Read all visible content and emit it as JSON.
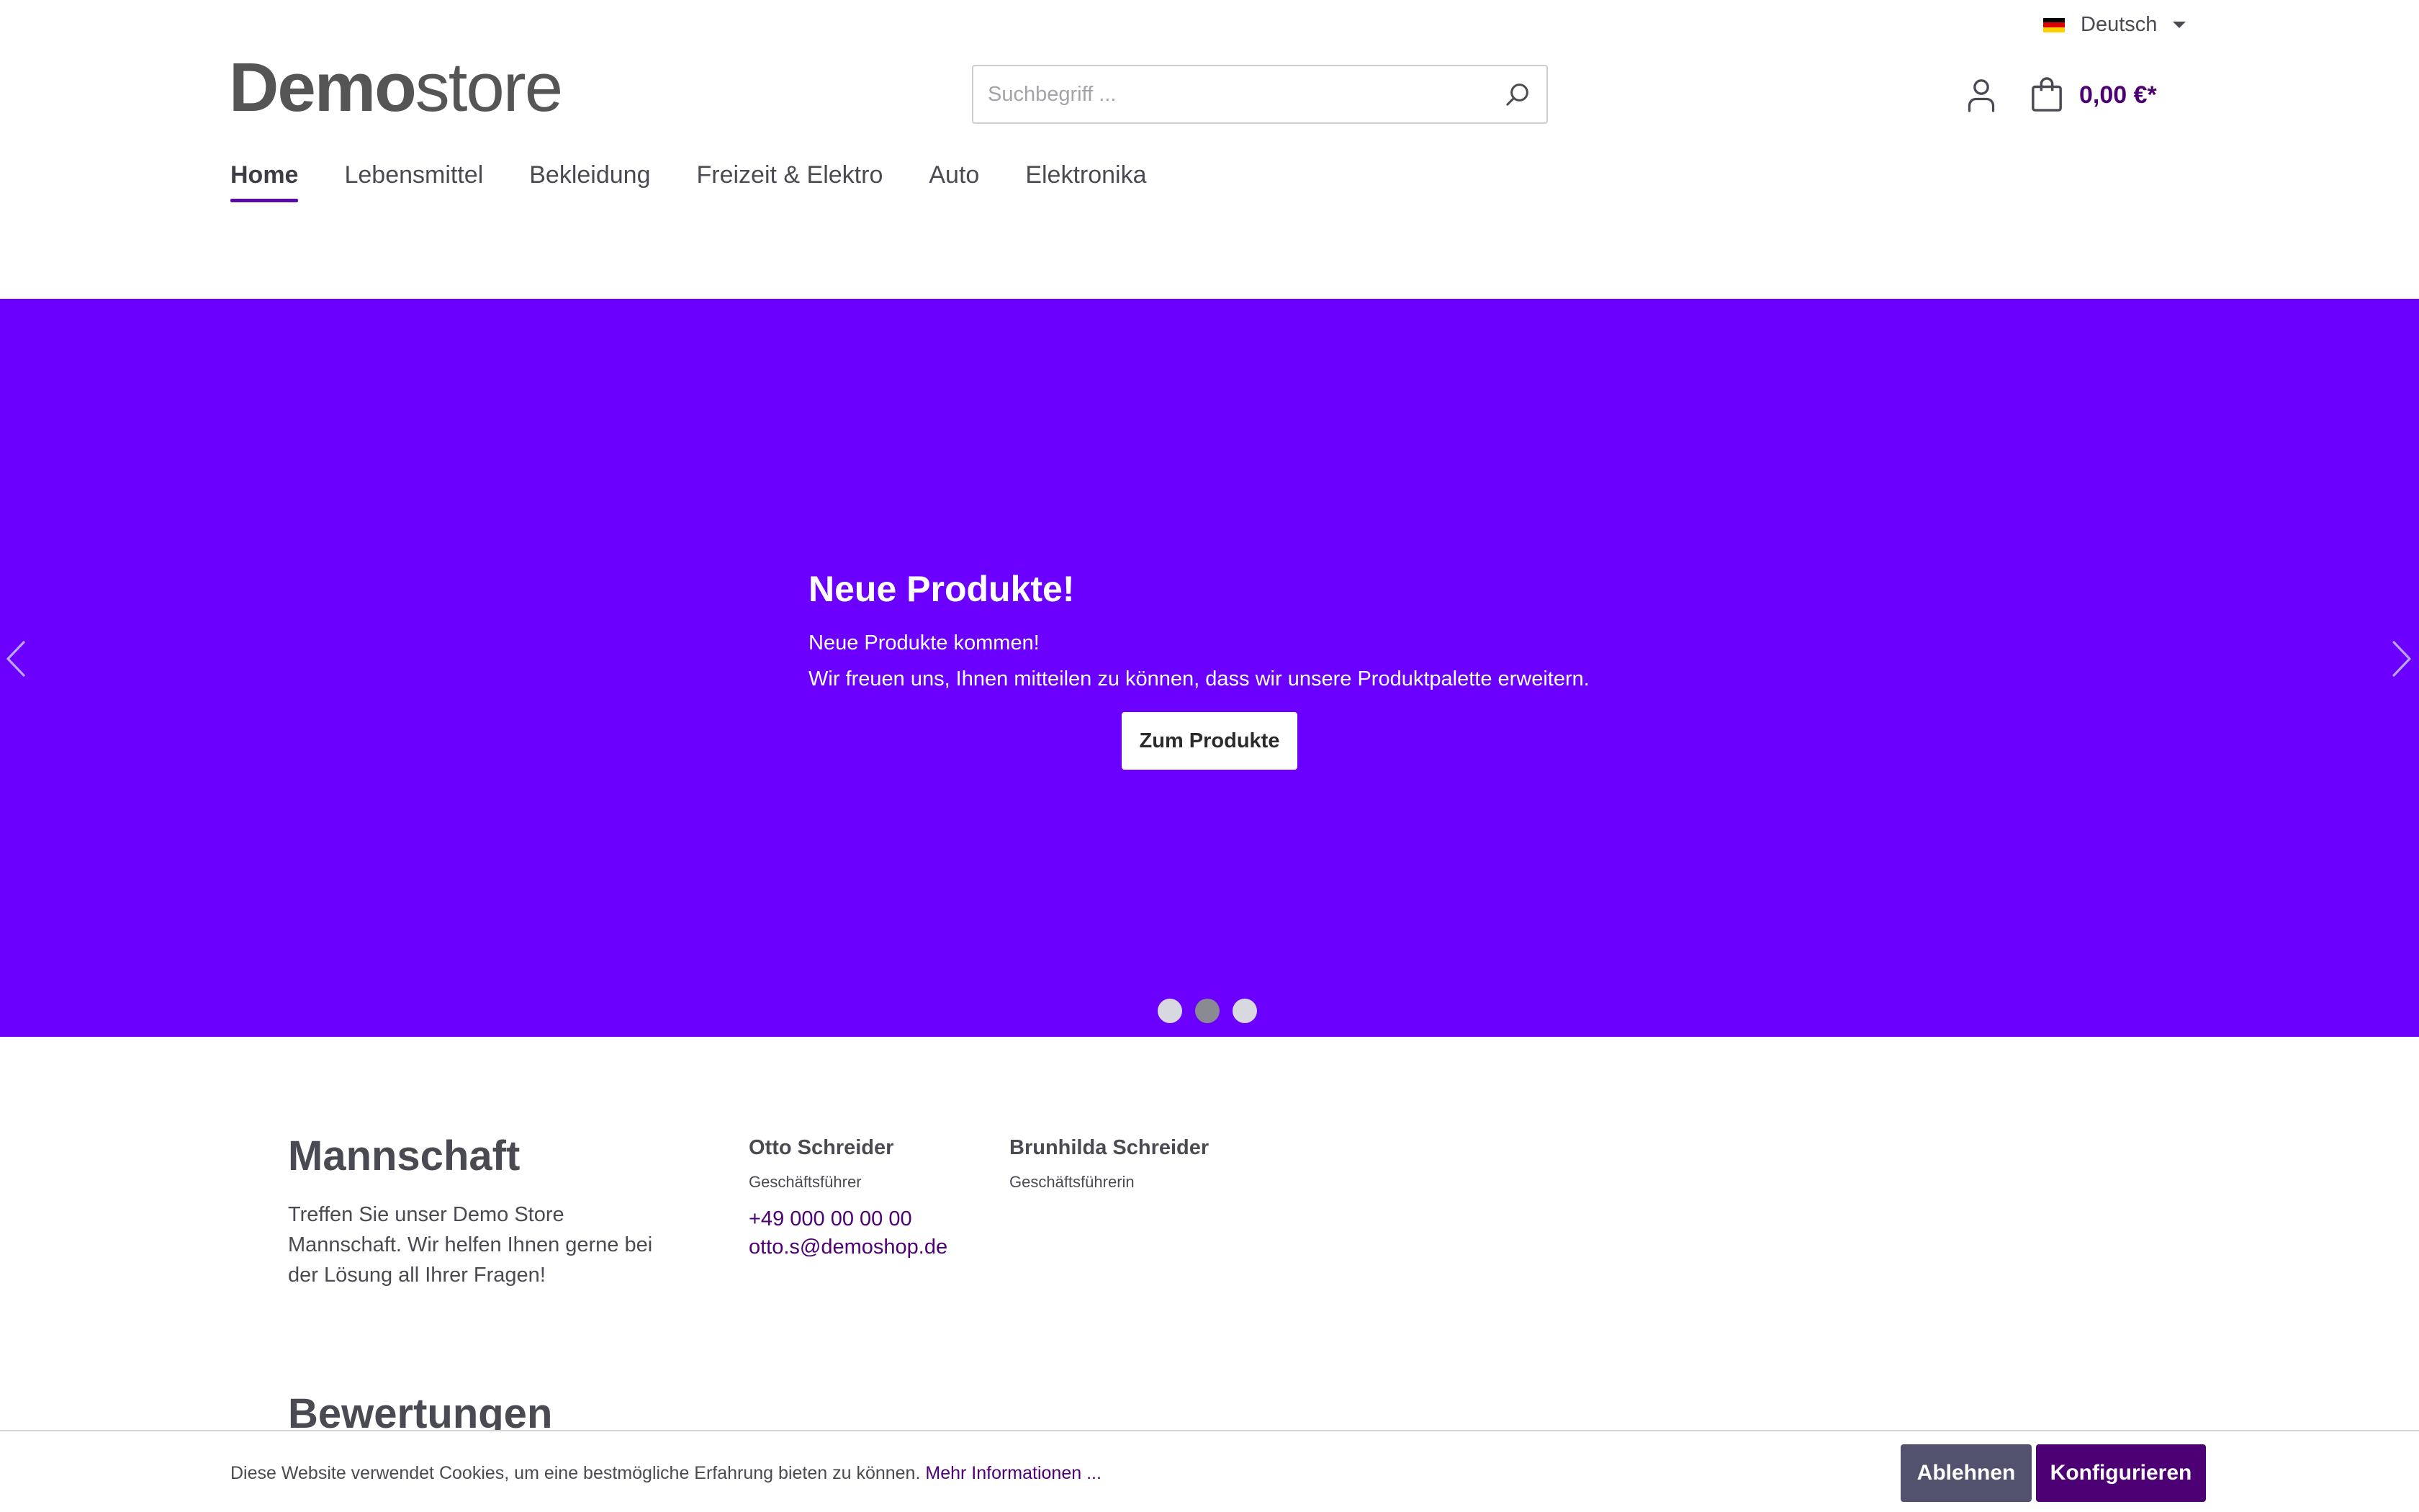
{
  "topbar": {
    "language": "Deutsch",
    "flag_colors": [
      "#000000",
      "#dd0000",
      "#ffce00"
    ]
  },
  "header": {
    "logo_bold": "Demo",
    "logo_light": "store",
    "search_placeholder": "Suchbegriff ...",
    "cart_total": "0,00 €*",
    "icons": {
      "search": "search-icon",
      "account": "user-icon",
      "cart": "shopping-bag-icon"
    }
  },
  "nav": {
    "items": [
      "Home",
      "Lebensmittel",
      "Bekleidung",
      "Freizeit & Elektro",
      "Auto",
      "Elektronika"
    ],
    "active_index": 0
  },
  "hero": {
    "title": "Neue Produkte!",
    "line1": "Neue Produkte kommen!",
    "line2": "Wir freuen uns, Ihnen mitteilen zu können, dass wir unsere Produktpalette erweitern.",
    "button": "Zum Produkte",
    "background_color": "#6b00ff",
    "slide_count": 3,
    "active_slide": 2
  },
  "team": {
    "title": "Mannschaft",
    "description": "Treffen Sie unser Demo Store Mannschaft. Wir helfen Ihnen gerne bei der Lösung all Ihrer Fragen!",
    "members": [
      {
        "name": "Otto Schreider",
        "role": "Geschäftsführer",
        "phone": "+49 000 00 00 00",
        "email": "otto.s@demoshop.de"
      },
      {
        "name": "Brunhilda Schreider",
        "role": "Geschäftsführerin"
      }
    ]
  },
  "reviews": {
    "title": "Bewertungen"
  },
  "cookie": {
    "text": "Diese Website verwendet Cookies, um eine bestmögliche Erfahrung bieten zu können.",
    "more": "Mehr Informationen ...",
    "decline": "Ablehnen",
    "configure": "Konfigurieren"
  },
  "colors": {
    "accent": "#4d0073",
    "hero": "#6b00ff",
    "decline_button": "#52526e"
  }
}
